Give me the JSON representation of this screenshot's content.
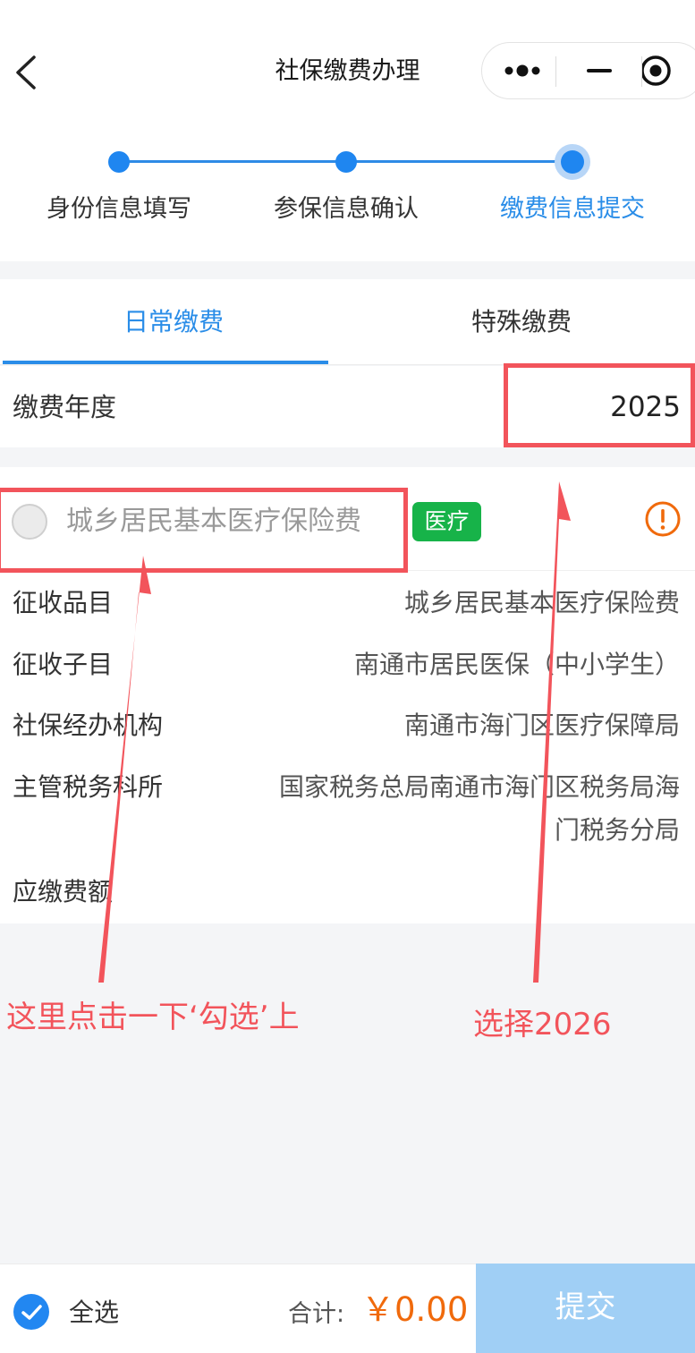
{
  "nav": {
    "title": "社保缴费办理",
    "back_icon": "chevron-left-icon",
    "more_icon": "more-dots-icon",
    "minimize_icon": "minus-icon",
    "close_icon": "target-icon"
  },
  "steps": [
    {
      "label": "身份信息填写",
      "state": "done"
    },
    {
      "label": "参保信息确认",
      "state": "done"
    },
    {
      "label": "缴费信息提交",
      "state": "active"
    }
  ],
  "tabs": [
    {
      "label": "日常缴费",
      "active": true
    },
    {
      "label": "特殊缴费",
      "active": false
    }
  ],
  "year": {
    "label": "缴费年度",
    "value": "2025"
  },
  "insurance": {
    "name": "城乡居民基本医疗保险费",
    "tag": "医疗",
    "tag_color": "#17b349",
    "checked": false,
    "info_icon": "alert-circle-icon",
    "details": {
      "item_key": "征收品目",
      "item_value": "城乡居民基本医疗保险费",
      "subitem_key": "征收子目",
      "subitem_value": "南通市居民医保（中小学生）",
      "agency_key": "社保经办机构",
      "agency_value": "南通市海门区医疗保障局",
      "tax_key": "主管税务科所",
      "tax_value_line1": "国家税务总局南通市海门区税务局海",
      "tax_value_line2": "门税务分局",
      "amount_key": "应缴费额",
      "amount_value": ""
    }
  },
  "annotations": {
    "left_text": "这里点击一下‘勾选’上",
    "right_text": "选择2026",
    "color": "#f2545b"
  },
  "footer": {
    "select_all": "全选",
    "select_all_checked": true,
    "total_label": "合计:",
    "total_value": "￥0.00",
    "submit": "提交",
    "accent": "#2a8de8",
    "price_color": "#f06a0c"
  }
}
